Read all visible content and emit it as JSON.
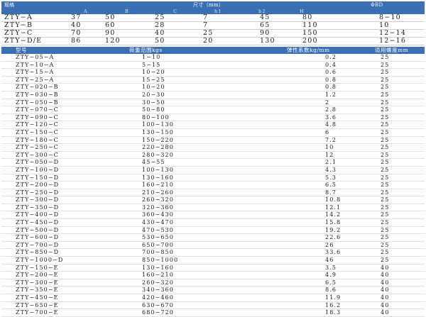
{
  "size_table": {
    "headers": [
      "规格",
      "A",
      "B",
      "C",
      "尺寸（mm）",
      "h1",
      "h2",
      "H",
      "ΦBD"
    ],
    "rows": [
      [
        "ZTY−A",
        "37",
        "50",
        "25",
        "7",
        "45",
        "80",
        "8−10"
      ],
      [
        "ZTY−B",
        "40",
        "60",
        "28",
        "7",
        "65",
        "110",
        "10"
      ],
      [
        "ZTY−C",
        "70",
        "90",
        "40",
        "25",
        "90",
        "150",
        "12−14"
      ],
      [
        "ZTY−D/E",
        "86",
        "120",
        "50",
        "20",
        "130",
        "200",
        "12−16"
      ]
    ]
  },
  "model_table": {
    "headers": [
      "型号",
      "荷重范围kgs",
      "弹性系数kg/mm",
      "适用螺度mm"
    ],
    "rows": [
      [
        "ZTY−05−A",
        "1−10",
        "0.2",
        "25"
      ],
      [
        "ZTY−10−A",
        "5−15",
        "0.4",
        "25"
      ],
      [
        "ZTY−15−A",
        "10−20",
        "0.6",
        "25"
      ],
      [
        "ZTY−25−A",
        "15−25",
        "0.8",
        "25"
      ],
      [
        "ZTY−020−B",
        "10−20",
        "0.8",
        "25"
      ],
      [
        "ZTY−030−B",
        "20−30",
        "1.2",
        "25"
      ],
      [
        "ZTY−050−B",
        "30−50",
        "2",
        "25"
      ],
      [
        "ZTY−070−C",
        "50−80",
        "2.8",
        "25"
      ],
      [
        "ZTY−090−C",
        "80−100",
        "3.6",
        "25"
      ],
      [
        "ZTY−120−C",
        "100−130",
        "4.8",
        "25"
      ],
      [
        "ZTY−150−C",
        "130−150",
        "6",
        "25"
      ],
      [
        "ZTY−180−C",
        "150−220",
        "7.2",
        "25"
      ],
      [
        "ZTY−250−C",
        "220−280",
        "10",
        "25"
      ],
      [
        "ZTY−300−C",
        "280−320",
        "12",
        "25"
      ],
      [
        "ZTY−050−D",
        "45−55",
        "2.1",
        "25"
      ],
      [
        "ZTY−100−D",
        "100−130",
        "4.3",
        "25"
      ],
      [
        "ZTY−150−D",
        "130−160",
        "5.3",
        "25"
      ],
      [
        "ZTY−200−D",
        "160−210",
        "6.5",
        "25"
      ],
      [
        "ZTY−250−D",
        "210−260",
        "8.7",
        "25"
      ],
      [
        "ZTY−300−D",
        "260−320",
        "10.8",
        "25"
      ],
      [
        "ZTY−350−D",
        "320−360",
        "12.1",
        "25"
      ],
      [
        "ZTY−400−D",
        "360−430",
        "14.2",
        "25"
      ],
      [
        "ZTY−450−D",
        "430−470",
        "15.8",
        "25"
      ],
      [
        "ZTY−500−D",
        "470−530",
        "19.2",
        "25"
      ],
      [
        "ZTY−600−D",
        "530−650",
        "22.6",
        "25"
      ],
      [
        "ZTY−700−D",
        "650−700",
        "26",
        "25"
      ],
      [
        "ZTY−850−D",
        "700−850",
        "33.6",
        "25"
      ],
      [
        "ZTY−1000−D",
        "850−1000",
        "46",
        "25"
      ],
      [
        "ZTY−150−E",
        "130−160",
        "3.5",
        "40"
      ],
      [
        "ZTY−200−E",
        "160−210",
        "4.9",
        "40"
      ],
      [
        "ZTY−300−E",
        "260−320",
        "6.5",
        "40"
      ],
      [
        "ZTY−350−E",
        "340−360",
        "8.6",
        "40"
      ],
      [
        "ZTY−450−E",
        "420−460",
        "11.9",
        "40"
      ],
      [
        "ZTY−650−E",
        "630−670",
        "16.2",
        "40"
      ],
      [
        "ZTY−700−E",
        "680−720",
        "18.3",
        "40"
      ]
    ]
  }
}
